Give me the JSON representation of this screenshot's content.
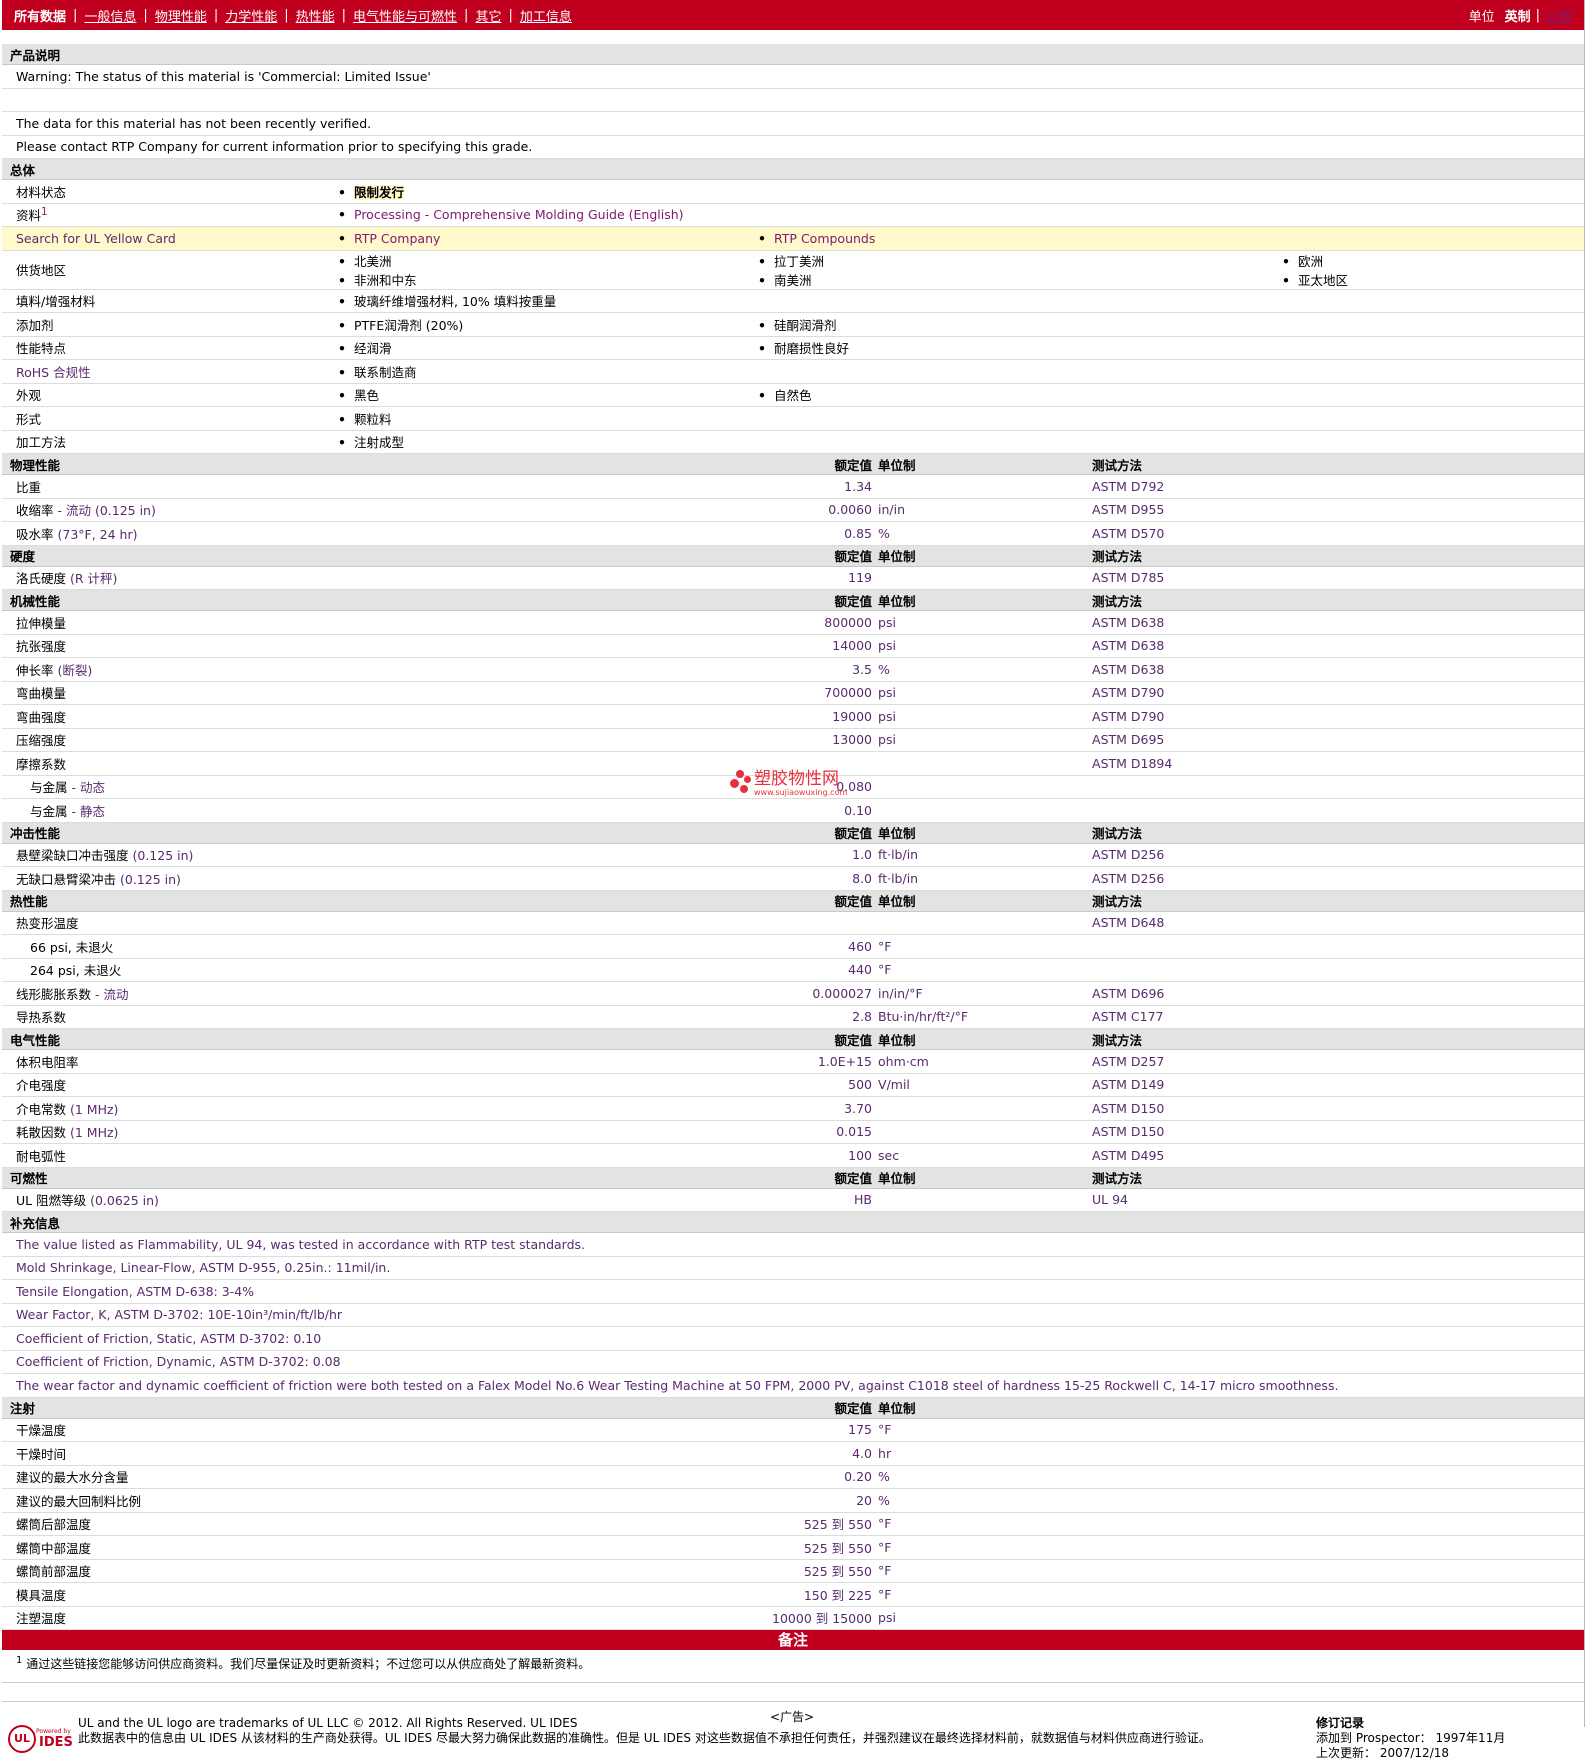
{
  "nav": {
    "tabs": [
      "所有数据",
      "一般信息",
      "物理性能",
      "力学性能",
      "热性能",
      "电气性能与可燃性",
      "其它",
      "加工信息"
    ],
    "units_label": "单位",
    "unit_english": "英制",
    "unit_metric": "公制"
  },
  "description": {
    "title": "产品说明",
    "lines": [
      "Warning: The status of this material is 'Commercial: Limited Issue'",
      "",
      "The data for this material has not been recently verified.",
      "Please contact RTP Company for current information prior to specifying this grade."
    ]
  },
  "general": {
    "title": "总体",
    "rows": [
      {
        "label": "材料状态",
        "c1": "限制发行",
        "c2": "",
        "c3": ""
      },
      {
        "label": "资料",
        "sup": "1",
        "c1": "Processing - Comprehensive Molding Guide (English)",
        "c2": "",
        "c3": ""
      },
      {
        "label": "Search for UL Yellow Card",
        "c1": "RTP Company",
        "c2": "RTP Compounds",
        "c3": ""
      },
      {
        "label": "供货地区",
        "c1": "北美洲",
        "c2": "拉丁美洲",
        "c3": "欧洲",
        "c1b": "非洲和中东",
        "c2b": "南美洲",
        "c3b": "亚太地区"
      },
      {
        "label": "填料/增强材料",
        "c1": "玻璃纤维增强材料, 10% 填料按重量",
        "c2": "",
        "c3": ""
      },
      {
        "label": "添加剂",
        "c1": "PTFE润滑剂 (20%)",
        "c2": "硅酮润滑剂",
        "c3": ""
      },
      {
        "label": "性能特点",
        "c1": "经润滑",
        "c2": "耐磨损性良好",
        "c3": ""
      },
      {
        "label": "RoHS 合规性",
        "c1": "联系制造商",
        "c2": "",
        "c3": ""
      },
      {
        "label": "外观",
        "c1": "黑色",
        "c2": "自然色",
        "c3": ""
      },
      {
        "label": "形式",
        "c1": "颗粒料",
        "c2": "",
        "c3": ""
      },
      {
        "label": "加工方法",
        "c1": "注射成型",
        "c2": "",
        "c3": ""
      }
    ]
  },
  "headers": {
    "value": "额定值",
    "unit": "单位制",
    "method": "测试方法"
  },
  "sections": [
    {
      "title": "物理性能",
      "rows": [
        {
          "label": "比重",
          "cond": "",
          "value": "1.34",
          "unit": "",
          "method": "ASTM D792"
        },
        {
          "label": "收缩率",
          "cond": " - 流动 (0.125 in)",
          "value": "0.0060",
          "unit": "in/in",
          "method": "ASTM D955"
        },
        {
          "label": "吸水率",
          "cond": " (73°F, 24 hr)",
          "value": "0.85",
          "unit": "%",
          "method": "ASTM D570"
        }
      ]
    },
    {
      "title": "硬度",
      "rows": [
        {
          "label": "洛氏硬度",
          "cond": " (R 计秤)",
          "value": "119",
          "unit": "",
          "method": "ASTM D785"
        }
      ]
    },
    {
      "title": "机械性能",
      "rows": [
        {
          "label": "拉伸模量",
          "cond": "",
          "value": "800000",
          "unit": "psi",
          "method": "ASTM D638"
        },
        {
          "label": "抗张强度",
          "cond": "",
          "value": "14000",
          "unit": "psi",
          "method": "ASTM D638"
        },
        {
          "label": "伸长率",
          "cond": " (断裂)",
          "value": "3.5",
          "unit": "%",
          "method": "ASTM D638"
        },
        {
          "label": "弯曲模量",
          "cond": "",
          "value": "700000",
          "unit": "psi",
          "method": "ASTM D790"
        },
        {
          "label": "弯曲强度",
          "cond": "",
          "value": "19000",
          "unit": "psi",
          "method": "ASTM D790"
        },
        {
          "label": "压缩强度",
          "cond": "",
          "value": "13000",
          "unit": "psi",
          "method": "ASTM D695"
        },
        {
          "label": "摩擦系数",
          "cond": "",
          "value": "",
          "unit": "",
          "method": "ASTM D1894"
        },
        {
          "label": "与金属",
          "cond": " - 动态",
          "value": "0.080",
          "unit": "",
          "method": "",
          "sub": true
        },
        {
          "label": "与金属",
          "cond": " - 静态",
          "value": "0.10",
          "unit": "",
          "method": "",
          "sub": true
        }
      ]
    },
    {
      "title": "冲击性能",
      "rows": [
        {
          "label": "悬壁梁缺口冲击强度",
          "cond": " (0.125 in)",
          "value": "1.0",
          "unit": "ft·lb/in",
          "method": "ASTM D256"
        },
        {
          "label": "无缺口悬臂梁冲击",
          "cond": " (0.125 in)",
          "value": "8.0",
          "unit": "ft·lb/in",
          "method": "ASTM D256"
        }
      ]
    },
    {
      "title": "热性能",
      "rows": [
        {
          "label": "热变形温度",
          "cond": "",
          "value": "",
          "unit": "",
          "method": "ASTM D648"
        },
        {
          "label": "66 psi, 未退火",
          "cond": "",
          "value": "460",
          "unit": "°F",
          "method": "",
          "sub": true
        },
        {
          "label": "264 psi, 未退火",
          "cond": "",
          "value": "440",
          "unit": "°F",
          "method": "",
          "sub": true
        },
        {
          "label": "线形膨胀系数",
          "cond": " - 流动",
          "value": "0.000027",
          "unit": "in/in/°F",
          "method": "ASTM D696"
        },
        {
          "label": "导热系数",
          "cond": "",
          "value": "2.8",
          "unit": "Btu·in/hr/ft²/°F",
          "method": "ASTM C177"
        }
      ]
    },
    {
      "title": "电气性能",
      "rows": [
        {
          "label": "体积电阻率",
          "cond": "",
          "value": "1.0E+15",
          "unit": "ohm·cm",
          "method": "ASTM D257"
        },
        {
          "label": "介电强度",
          "cond": "",
          "value": "500",
          "unit": "V/mil",
          "method": "ASTM D149"
        },
        {
          "label": "介电常数",
          "cond": " (1 MHz)",
          "value": "3.70",
          "unit": "",
          "method": "ASTM D150"
        },
        {
          "label": "耗散因数",
          "cond": " (1 MHz)",
          "value": "0.015",
          "unit": "",
          "method": "ASTM D150"
        },
        {
          "label": "耐电弧性",
          "cond": "",
          "value": "100",
          "unit": "sec",
          "method": "ASTM D495"
        }
      ]
    },
    {
      "title": "可燃性",
      "rows": [
        {
          "label": "UL 阻燃等级",
          "cond": " (0.0625 in)",
          "value": "HB",
          "unit": "",
          "method": "UL 94"
        }
      ]
    }
  ],
  "supplement": {
    "title": "补充信息",
    "lines": [
      "The value listed as Flammability, UL 94, was tested in accordance with RTP test standards.",
      "Mold Shrinkage, Linear-Flow, ASTM D-955, 0.25in.: 11mil/in.",
      "Tensile Elongation, ASTM D-638: 3-4%",
      "Wear Factor, K, ASTM D-3702: 10E-10in³/min/ft/lb/hr",
      "Coefficient of Friction, Static, ASTM D-3702: 0.10",
      "Coefficient of Friction, Dynamic, ASTM D-3702: 0.08",
      "The wear factor and dynamic coefficient of friction were both tested on a Falex Model No.6 Wear Testing Machine at 50 FPM, 2000 PV, against C1018 steel of hardness 15-25 Rockwell C, 14-17 micro smoothness."
    ]
  },
  "injection": {
    "title": "注射",
    "rows": [
      {
        "label": "干燥温度",
        "value": "175",
        "unit": "°F"
      },
      {
        "label": "干燥时间",
        "value": "4.0",
        "unit": "hr"
      },
      {
        "label": "建议的最大水分含量",
        "value": "0.20",
        "unit": "%"
      },
      {
        "label": "建议的最大回制料比例",
        "value": "20",
        "unit": "%"
      },
      {
        "label": "螺筒后部温度",
        "value": "525 到  550",
        "unit": "°F"
      },
      {
        "label": "螺筒中部温度",
        "value": "525 到  550",
        "unit": "°F"
      },
      {
        "label": "螺筒前部温度",
        "value": "525 到  550",
        "unit": "°F"
      },
      {
        "label": "模具温度",
        "value": "150 到  225",
        "unit": "°F"
      },
      {
        "label": "注塑温度",
        "value": "10000 到  15000",
        "unit": "psi"
      }
    ]
  },
  "remarks": {
    "title": "备注",
    "footnote_sup": "1",
    "footnote": "通过这些链接您能够访问供应商资料。我们尽量保证及时更新资料；不过您可以从供应商处了解最新资料。"
  },
  "footer": {
    "powered": "Powered by",
    "logo_ul": "UL",
    "logo_ides": "IDES",
    "line1": "UL and the UL logo are trademarks of UL LLC © 2012. All Rights Reserved. UL IDES",
    "line2": "此数据表中的信息由 UL IDES 从该材料的生产商处获得。UL IDES 尽最大努力确保此数据的准确性。但是 UL IDES 对这些数据值不承担任何责任，并强烈建议在最终选择材料前，就数据值与材料供应商进行验证。",
    "rev_title": "修订记录",
    "rev_added_label": "添加到 Prospector：",
    "rev_added": "1997年11月",
    "rev_updated_label": "上次更新：",
    "rev_updated": "2007/12/18",
    "ad": "<广告>"
  },
  "watermark": {
    "text": "塑胶物性网",
    "sub": "www.sujiaowuxing.com"
  },
  "colors": {
    "brand": "#c1001f",
    "link": "#801b6e",
    "header_bg": "#e3e3e3",
    "highlight": "#fff9cc"
  }
}
